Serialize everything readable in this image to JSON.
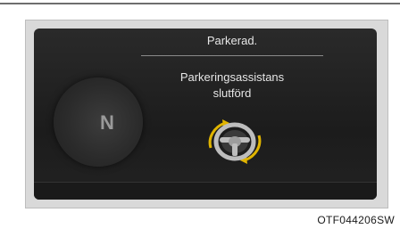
{
  "display": {
    "title": "Parkerad.",
    "message_line1": "Parkeringsassistans",
    "message_line2": "slutförd",
    "gear_indicator": "N",
    "icon": "steering-wheel-icon"
  },
  "caption": "OTF044206SW",
  "colors": {
    "screen_bg": "#1c1c1c",
    "text": "#e6e6e6",
    "arrow_accent": "#e0b400"
  }
}
